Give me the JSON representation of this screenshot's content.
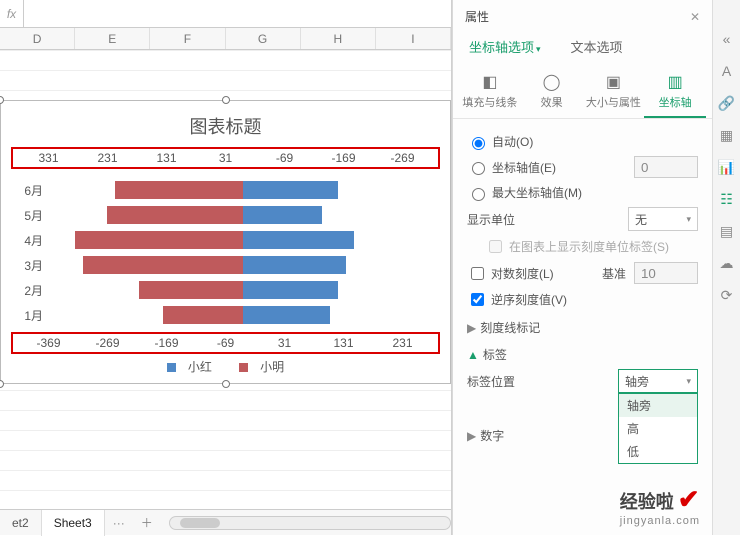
{
  "columns": [
    "D",
    "E",
    "F",
    "G",
    "H",
    "I"
  ],
  "chart_data": {
    "type": "bar",
    "title": "图表标题",
    "categories": [
      "1月",
      "2月",
      "3月",
      "4月",
      "5月",
      "6月"
    ],
    "series": [
      {
        "name": "小红",
        "values": [
          100,
          130,
          200,
          210,
          170,
          160
        ],
        "color": "#bf5a5c"
      },
      {
        "name": "小明",
        "values": [
          110,
          120,
          130,
          140,
          100,
          120
        ],
        "color": "#4f88c6"
      }
    ],
    "top_axis_ticks": [
      "331",
      "231",
      "131",
      "31",
      "-69",
      "-169",
      "-269"
    ],
    "bottom_axis_ticks": [
      "-369",
      "-269",
      "-169",
      "-69",
      "31",
      "131",
      "231"
    ]
  },
  "sheet_tabs": {
    "items": [
      "et2",
      "Sheet3"
    ],
    "more": "···",
    "add": "＋"
  },
  "panel": {
    "title": "属性",
    "tabs": {
      "axis_options": "坐标轴选项",
      "text_options": "文本选项"
    },
    "icon_tabs": {
      "fill": "填充与线条",
      "effects": "效果",
      "size": "大小与属性",
      "axis": "坐标轴"
    },
    "radios": {
      "auto": "自动(O)",
      "axis_value": "坐标轴值(E)",
      "max_axis_value": "最大坐标轴值(M)",
      "axis_value_num": "0"
    },
    "display_unit": {
      "label": "显示单位",
      "value": "无"
    },
    "show_unit_label": "在图表上显示刻度单位标签(S)",
    "log_scale": {
      "label": "对数刻度(L)",
      "base_label": "基准",
      "base_value": "10"
    },
    "reverse": "逆序刻度值(V)",
    "ticks_section": "刻度线标记",
    "labels_section": "标签",
    "label_pos": {
      "label": "标签位置",
      "value": "轴旁",
      "options": [
        "轴旁",
        "高",
        "低"
      ]
    },
    "numbers_section": "数字"
  },
  "watermark": {
    "main": "经验啦",
    "sub": "jingyanla.com"
  }
}
